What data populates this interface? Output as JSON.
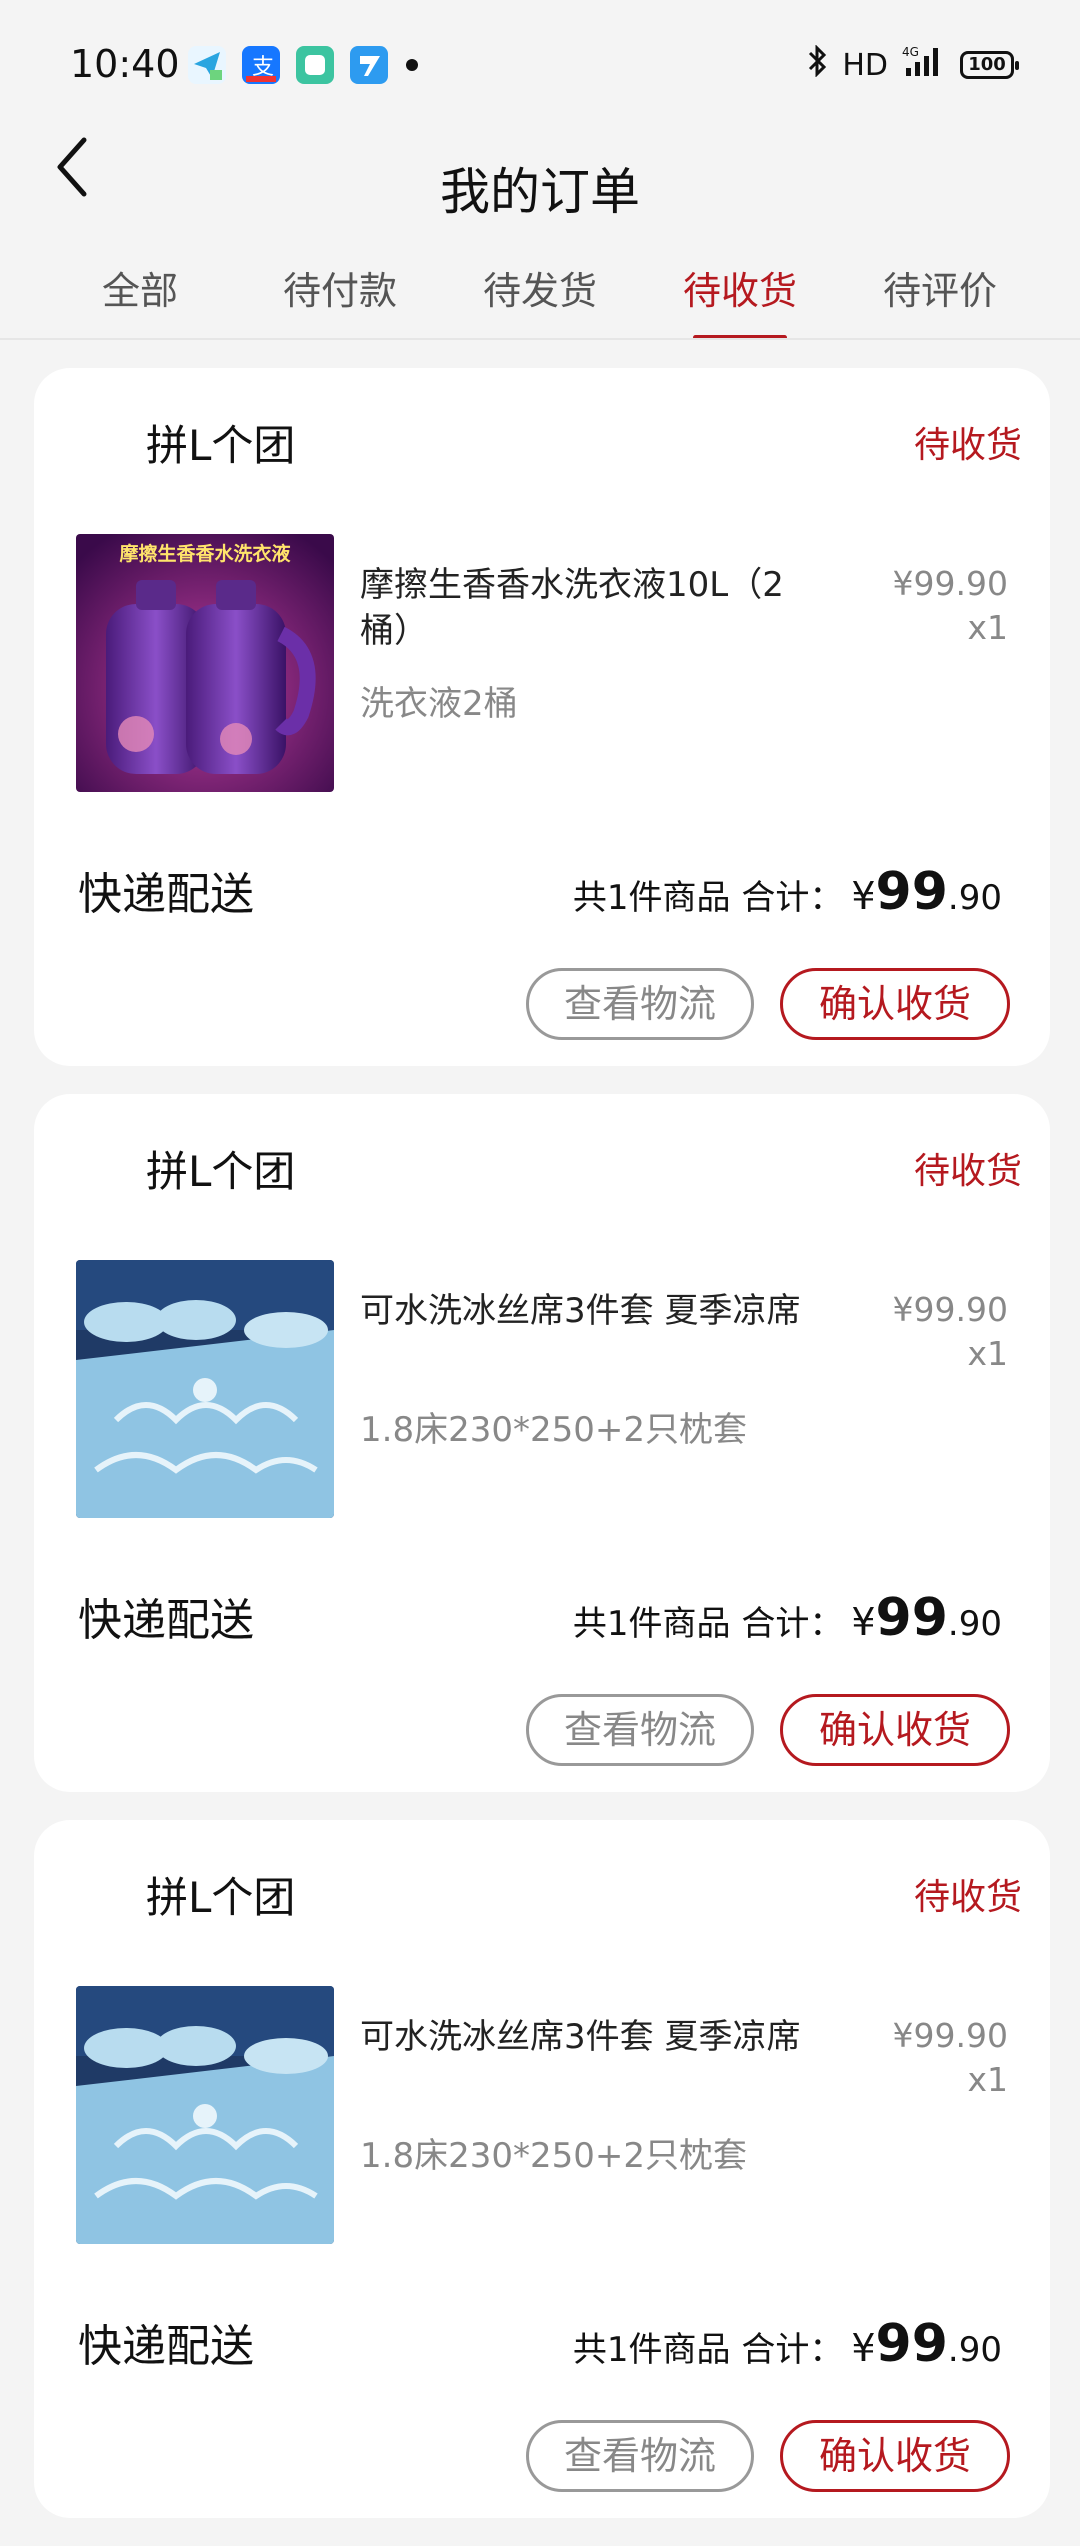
{
  "status_bar": {
    "time": "10:40",
    "network": "HD",
    "signal": "4G",
    "battery": "100",
    "icons": [
      "telegram-icon",
      "alipay-icon",
      "app-icon",
      "feishu-icon",
      "bluetooth-icon",
      "signal-icon",
      "battery-icon"
    ]
  },
  "header": {
    "title": "我的订单",
    "back_icon": "chevron-left-icon"
  },
  "tabs": [
    {
      "label": "全部"
    },
    {
      "label": "待付款"
    },
    {
      "label": "待发货"
    },
    {
      "label": "待收货",
      "active": true
    },
    {
      "label": "待评价"
    }
  ],
  "accent_color": "#b5191f",
  "orders": [
    {
      "shop": "拼L个团",
      "status": "待收货",
      "product_title": "摩擦生香香水洗衣液10L（2桶）",
      "product_spec": "洗衣液2桶",
      "price": "¥99.90",
      "qty": "x1",
      "shipping": "快递配送",
      "count_text": "共1件商品 合计：",
      "total_yen": "¥",
      "total_int": "99",
      "total_dec": ".90",
      "btn_logistics": "查看物流",
      "btn_confirm": "确认收货",
      "thumb_text": "摩擦生香香水洗衣液"
    },
    {
      "shop": "拼L个团",
      "status": "待收货",
      "product_title": "可水洗冰丝席3件套 夏季凉席",
      "product_spec": "1.8床230*250+2只枕套",
      "price": "¥99.90",
      "qty": "x1",
      "shipping": "快递配送",
      "count_text": "共1件商品 合计：",
      "total_yen": "¥",
      "total_int": "99",
      "total_dec": ".90",
      "btn_logistics": "查看物流",
      "btn_confirm": "确认收货"
    },
    {
      "shop": "拼L个团",
      "status": "待收货",
      "product_title": "可水洗冰丝席3件套 夏季凉席",
      "product_spec": "1.8床230*250+2只枕套",
      "price": "¥99.90",
      "qty": "x1",
      "shipping": "快递配送",
      "count_text": "共1件商品 合计：",
      "total_yen": "¥",
      "total_int": "99",
      "total_dec": ".90",
      "btn_logistics": "查看物流",
      "btn_confirm": "确认收货"
    }
  ]
}
